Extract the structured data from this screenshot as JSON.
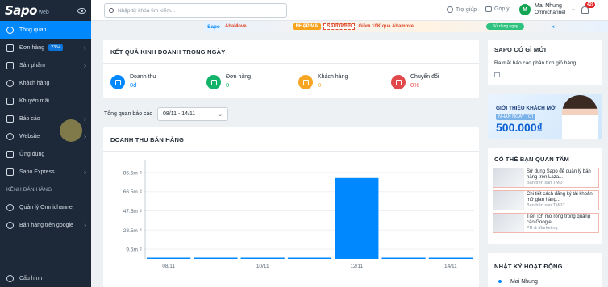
{
  "app": {
    "logo": "Sapo",
    "logo_sub": "web"
  },
  "sidebar": {
    "items": [
      {
        "label": "Tổng quan",
        "active": true,
        "chevron": false,
        "badge": "",
        "icon": "home-icon"
      },
      {
        "label": "Đơn hàng",
        "active": false,
        "chevron": true,
        "badge": "2354",
        "icon": "order-icon"
      },
      {
        "label": "Sản phẩm",
        "active": false,
        "chevron": true,
        "badge": "",
        "icon": "product-icon"
      },
      {
        "label": "Khách hàng",
        "active": false,
        "chevron": false,
        "badge": "",
        "icon": "customer-icon"
      },
      {
        "label": "Khuyến mãi",
        "active": false,
        "chevron": false,
        "badge": "",
        "icon": "promotion-icon"
      },
      {
        "label": "Báo cáo",
        "active": false,
        "chevron": true,
        "badge": "",
        "icon": "report-icon"
      },
      {
        "label": "Website",
        "active": false,
        "chevron": true,
        "badge": "",
        "icon": "website-icon"
      },
      {
        "label": "Ứng dụng",
        "active": false,
        "chevron": false,
        "badge": "",
        "icon": "apps-icon"
      },
      {
        "label": "Sapo Express",
        "active": false,
        "chevron": true,
        "badge": "",
        "icon": "express-icon"
      }
    ],
    "section_title": "KÊNH BÁN HÀNG",
    "channels": [
      {
        "label": "Quản lý Omnichannel",
        "chevron": false,
        "icon": "omnichannel-icon"
      },
      {
        "label": "Bán hàng trên google",
        "chevron": true,
        "icon": "google-icon"
      }
    ],
    "settings_label": "Cấu hình"
  },
  "topbar": {
    "search_placeholder": "Nhập từ khóa tìm kiếm...",
    "help_label": "Trợ giúp",
    "feedback_label": "Góp ý",
    "avatar_initial": "M",
    "user_name": "Mai Nhung",
    "user_store": "Omnichannel",
    "notification_count": "429"
  },
  "banner": {
    "logo1": "Sapo",
    "logo2": "AhaMove",
    "code_label": "NHẬP MÃ",
    "code": "SAPOWEB",
    "text": "Giảm 10K qua Ahamove",
    "button": "Sử dụng ngay",
    "close": "×"
  },
  "results": {
    "title": "KẾT QUẢ KINH DOANH TRONG NGÀY",
    "metrics": [
      {
        "label": "Doanh thu",
        "value": "0đ",
        "color": "#0088ff",
        "value_color": "#0088ff",
        "icon": "dollar-icon"
      },
      {
        "label": "Đơn hàng",
        "value": "0",
        "color": "#13b36a",
        "value_color": "#13b36a",
        "icon": "cart-icon"
      },
      {
        "label": "Khách hàng",
        "value": "0",
        "color": "#f6a623",
        "value_color": "#f6a623",
        "icon": "users-icon"
      },
      {
        "label": "Chuyển đổi",
        "value": "0%",
        "color": "#e0484a",
        "value_color": "#e0484a",
        "icon": "conversion-icon"
      }
    ]
  },
  "period": {
    "label": "Tổng quan báo cáo",
    "value": "08/11 - 14/11"
  },
  "sales_chart": {
    "title": "DOANH THU BÁN HÀNG"
  },
  "chart_data": {
    "type": "bar",
    "categories": [
      "08/11",
      "09/11",
      "10/11",
      "11/11",
      "12/11",
      "13/11",
      "14/11"
    ],
    "x_tick_labels": [
      "08/11",
      "10/11",
      "12/11",
      "14/11"
    ],
    "values": [
      0,
      0,
      0,
      0,
      80000000,
      0,
      0
    ],
    "y_tick_labels": [
      "85.5m ₫",
      "66.5m ₫",
      "47.5m ₫",
      "28.5m ₫",
      "9.5m ₫"
    ],
    "y_ticks": [
      85500000,
      66500000,
      47500000,
      28500000,
      9500000
    ],
    "ylim": [
      0,
      95000000
    ],
    "bar_color": "#0088ff",
    "grid": true
  },
  "news": {
    "title": "SAPO CÓ GÌ MỚI",
    "text": "Ra mắt báo cáo phân tích giỏ hàng"
  },
  "promo": {
    "line1": "GIỚI THIỆU KHÁCH MỚI",
    "line2": "NHẬN NGAY TỚI",
    "line3": "500.000₫"
  },
  "interest": {
    "title": "CÓ THỂ BẠN QUAN TÂM",
    "articles": [
      {
        "title": "Sử dụng Sapo để quản lý bán hàng trên Laza...",
        "tag": "Bán trên sàn TMĐT"
      },
      {
        "title": "Chi tiết cách đăng ký tài khoản mở gian hàng...",
        "tag": "Bán trên sàn TMĐT"
      },
      {
        "title": "Tiện ích mở rộng trong quảng cáo Google...",
        "tag": "PR & Marketing"
      }
    ]
  },
  "activity": {
    "title": "NHẬT KÝ HOẠT ĐỘNG",
    "user": "Mai Nhung"
  }
}
